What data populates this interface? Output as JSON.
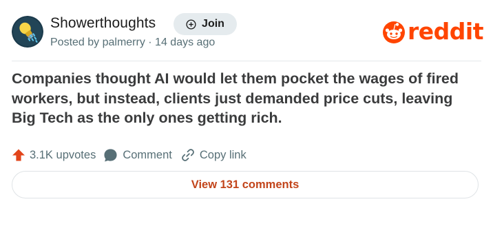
{
  "header": {
    "community_name": "Showerthoughts",
    "posted_by": "Posted by palmerry · 14 days ago",
    "join_label": "Join",
    "join_icon": "plus-circle-icon",
    "avatar_icon": "lightbulb-shower-icon"
  },
  "brand": {
    "wordmark": "reddit",
    "logo_icon": "snoo-icon",
    "color": "#ff4500"
  },
  "post": {
    "title": "Companies thought AI would let them pocket the wages of fired workers, but instead, clients just demanded price cuts, leaving Big Tech as the only ones getting rich."
  },
  "actions": {
    "upvotes": "3.1K upvotes",
    "upvote_icon": "upvote-arrow-icon",
    "comment": "Comment",
    "comment_icon": "speech-bubble-icon",
    "copy_link": "Copy link",
    "copy_link_icon": "link-icon"
  },
  "view_comments": {
    "label": "View 131 comments",
    "color": "#c2441a"
  }
}
